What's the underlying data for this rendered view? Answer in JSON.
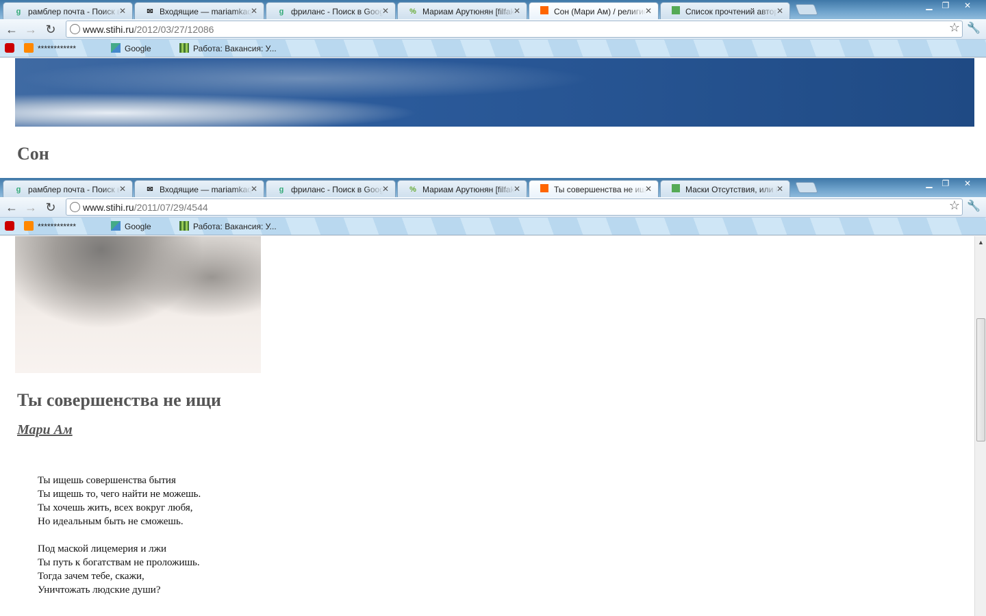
{
  "window1": {
    "tabs": [
      {
        "label": "рамблер почта - Поиск в Google",
        "icon": "google-icon",
        "active": false
      },
      {
        "label": "Входящие — mariamkaqu",
        "icon": "mail-icon",
        "active": false
      },
      {
        "label": "фриланс - Поиск в Google",
        "icon": "google-icon",
        "active": false
      },
      {
        "label": "Мариам Арутюнян [filfak]",
        "icon": "filfak-icon",
        "active": false
      },
      {
        "label": "Сон (Мари Ам) / религио",
        "icon": "stihi-icon",
        "active": true
      },
      {
        "label": "Список прочтений автор",
        "icon": "stihi-green-icon",
        "active": false
      }
    ],
    "url_host": "www.stihi.ru",
    "url_path": "/2012/03/27/12086",
    "page_title": "Сон"
  },
  "window2": {
    "tabs": [
      {
        "label": "рамблер почта - Поиск в Google",
        "icon": "google-icon",
        "active": false
      },
      {
        "label": "Входящие — mariamkaqu",
        "icon": "mail-icon",
        "active": false
      },
      {
        "label": "фриланс - Поиск в Google",
        "icon": "google-icon",
        "active": false
      },
      {
        "label": "Мариам Арутюнян [filfak]",
        "icon": "filfak-icon",
        "active": false
      },
      {
        "label": "Ты совершенства не ищи",
        "icon": "stihi-icon",
        "active": true
      },
      {
        "label": "Маски Отсутствия, или Н",
        "icon": "stihi-green-icon",
        "active": false
      }
    ],
    "url_host": "www.stihi.ru",
    "url_path": "/2011/07/29/4544",
    "page_title": "Ты совершенства не ищи",
    "author": "Мари Ам",
    "poem_lines": [
      "Ты ищешь совершенства бытия",
      "Ты ищешь то, чего найти не можешь.",
      "Ты хочешь жить, всех вокруг любя,",
      "Но идеальным быть не сможешь.",
      "",
      "Под маской лицемерия и лжи",
      "Ты путь к богатствам не проложишь.",
      "Тогда зачем тебе, скажи,",
      "Уничтожать людские души?"
    ]
  },
  "bookmarks": [
    {
      "label": "",
      "icon": "youtube-icon"
    },
    {
      "label": "************",
      "icon": "odnoklassniki-icon"
    },
    {
      "label": "Google",
      "icon": "google-icon"
    },
    {
      "label": "Работа: Вакансия: У...",
      "icon": "rabota-icon"
    }
  ],
  "colors": {
    "accent": "#3f78a8",
    "heading": "#555555"
  }
}
